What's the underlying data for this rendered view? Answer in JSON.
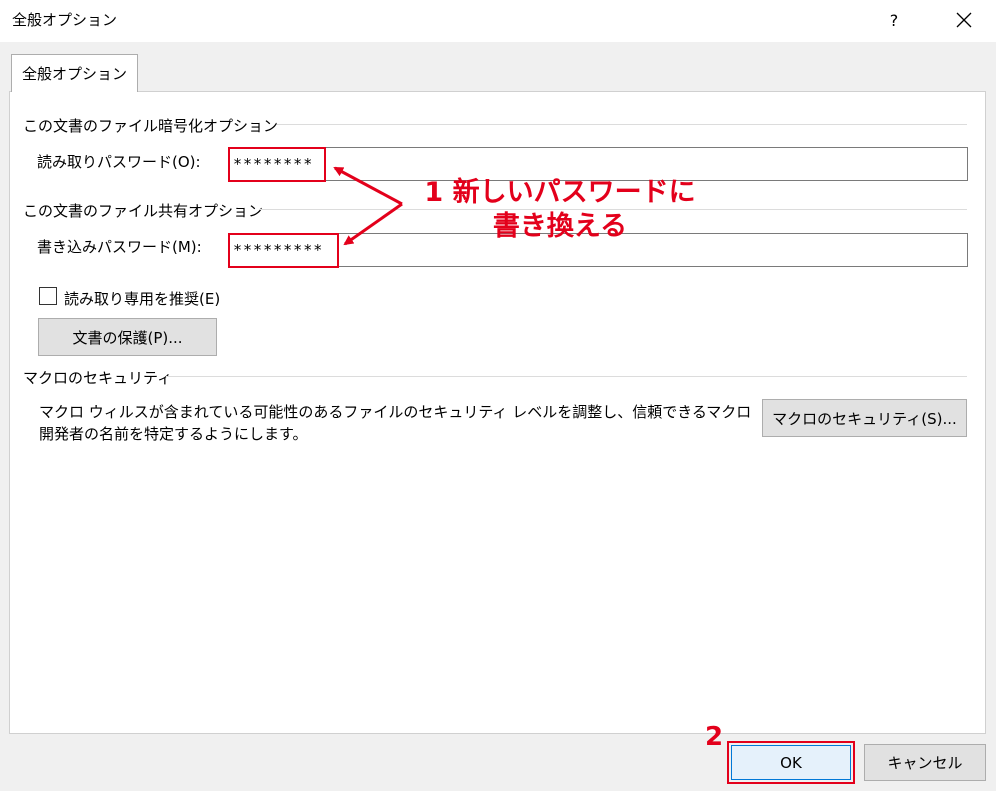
{
  "window": {
    "title": "全般オプション",
    "help_label": "?"
  },
  "tab": {
    "label": "全般オプション"
  },
  "encryption": {
    "group_label": "この文書のファイル暗号化オプション",
    "read_password_label": "読み取りパスワード(O):",
    "read_password_value": "********"
  },
  "sharing": {
    "group_label": "この文書のファイル共有オプション",
    "write_password_label": "書き込みパスワード(M):",
    "write_password_value": "*********"
  },
  "readonly_checkbox": {
    "label": "読み取り専用を推奨(E)",
    "checked": false
  },
  "protect_button": {
    "label": "文書の保護(P)..."
  },
  "macro": {
    "group_label": "マクロのセキュリティ",
    "description": "マクロ ウィルスが含まれている可能性のあるファイルのセキュリティ レベルを調整し、信頼できるマクロ開発者の名前を特定するようにします。",
    "button_label": "マクロのセキュリティ(S)..."
  },
  "footer": {
    "ok_label": "OK",
    "cancel_label": "キャンセル"
  },
  "annotations": {
    "step1_line1": "1 新しいパスワードに",
    "step1_line2": "書き換える",
    "step2": "2",
    "color": "#e3001b"
  }
}
